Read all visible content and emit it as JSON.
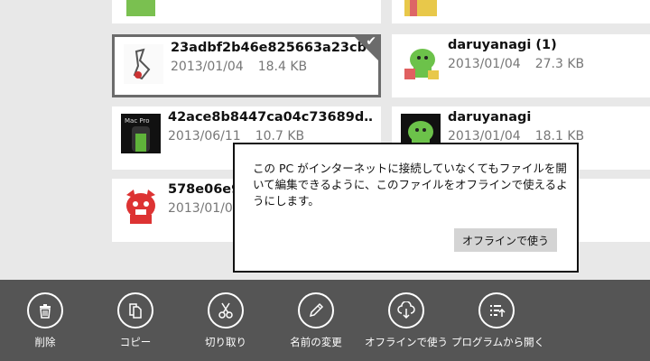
{
  "files": [
    {
      "name": "23adbf2b46e825663a23cb",
      "date": "2013/01/04",
      "size": "18.4 KB",
      "selected": true,
      "thumb": "hand-drawing-thumbnail"
    },
    {
      "name": "daruyanagi (1)",
      "date": "2013/01/04",
      "size": "27.3 KB",
      "selected": false,
      "thumb": "green-character-thumbnail"
    },
    {
      "name": "42ace8b8447ca04c73689d…",
      "date": "2013/06/11",
      "size": "10.7 KB",
      "selected": false,
      "thumb": "macpro-thumbnail"
    },
    {
      "name": "daruyanagi",
      "date": "2013/01/04",
      "size": "18.1 KB",
      "selected": false,
      "thumb": "green-character-thumbnail"
    },
    {
      "name": "578e06e9",
      "date": "2013/01/0",
      "size": "",
      "selected": false,
      "thumb": "red-character-thumbnail"
    }
  ],
  "popup": {
    "message": "この PC がインターネットに接続していなくてもファイルを開いて編集できるように、このファイルをオフラインで使えるようにします。",
    "button": "オフラインで使う"
  },
  "appbar": {
    "commands": [
      {
        "label": "削除",
        "icon": "trash-icon"
      },
      {
        "label": "コピー",
        "icon": "copy-icon"
      },
      {
        "label": "切り取り",
        "icon": "scissors-icon"
      },
      {
        "label": "名前の変更",
        "icon": "pencil-icon"
      },
      {
        "label": "オフラインで使う",
        "icon": "cloud-download-icon"
      },
      {
        "label": "プログラムから開く",
        "icon": "open-with-icon"
      }
    ]
  },
  "colors": {
    "appbar": "#555555",
    "selection": "#6b6b6b"
  }
}
